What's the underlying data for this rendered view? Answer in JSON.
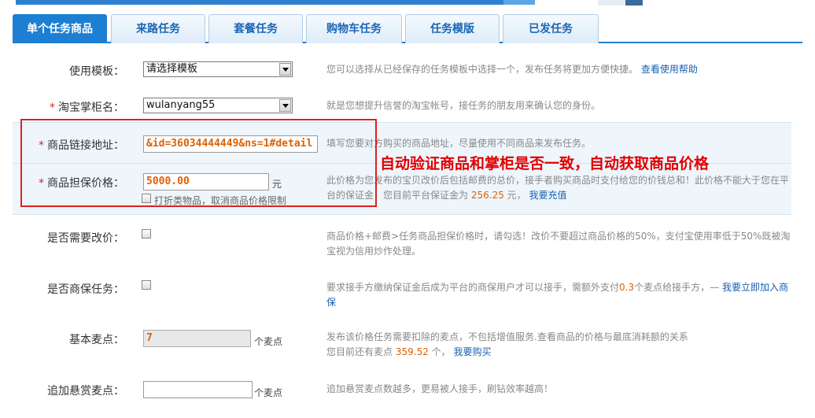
{
  "tabs": [
    {
      "label": "单个任务商品"
    },
    {
      "label": "来路任务"
    },
    {
      "label": "套餐任务"
    },
    {
      "label": "购物车任务"
    },
    {
      "label": "任务模版"
    },
    {
      "label": "已发任务"
    }
  ],
  "template": {
    "label": "使用模板：",
    "value": "请选择模板",
    "hint": "您可以选择从已经保存的任务模板中选择一个，发布任务将更加方便快捷。",
    "help_link": "查看使用帮助"
  },
  "shopkeeper": {
    "required": "*",
    "label": "淘宝掌柜名：",
    "value": "wulanyang55",
    "hint": "就是您想提升信誉的淘宝帐号，接任务的朋友用来确认您的身份。"
  },
  "product_link": {
    "required": "*",
    "label": "商品链接地址：",
    "value": "&id=36034444449&ns=1#detail",
    "hint": "填写您要对方购买的商品地址，尽量使用不同商品来发布任务。"
  },
  "price": {
    "required": "*",
    "label": "商品担保价格：",
    "value": "5000.00",
    "unit": "元",
    "discount_label": "打折类物品，取消商品价格限制",
    "hint_1": "此价格为您发布的宝贝改价后包括邮费的总价，接手者购买商品时支付给您的价钱总和！此价格不能大于您在平台的保证金！您目前平台保证金为",
    "deposit": "256.25",
    "hint_2": "元，",
    "recharge_link": "我要充值"
  },
  "annotation": "自动验证商品和掌柜是否一致，自动获取商品价格",
  "modify_price": {
    "label": "是否需要改价：",
    "hint": "商品价格+邮费>任务商品担保价格时，请勾选！改价不要超过商品价格的50%，支付宝使用率低于50%既被淘宝视为信用炒作处理。"
  },
  "merchant_task": {
    "label": "是否商保任务：",
    "hint_1": "要求接手方缴纳保证金后成为平台的商保用户才可以接手，需额外支付",
    "points": "0.3",
    "hint_2": "个麦点给接手方，—",
    "join_link": "我要立即加入商保"
  },
  "basic_points": {
    "label": "基本麦点：",
    "value": "7",
    "unit": "个麦点",
    "hint_1": "发布该价格任务需要扣除的麦点，不包括增值服务.查看商品的价格与最底消耗额的关系",
    "hint_2": "您目前还有麦点",
    "balance": "359.52",
    "hint_3": "个，",
    "buy_link": "我要购买"
  },
  "reward_points": {
    "label": "追加悬赏麦点：",
    "value": "",
    "unit": "个麦点",
    "hint": "追加悬赏麦点数越多，更易被人接手，刷钻效率越高！"
  },
  "colors": {
    "accent": "#1d7fd3",
    "annotation": "#e00000",
    "highlight": "#e06000",
    "link": "#1a5fb0"
  }
}
